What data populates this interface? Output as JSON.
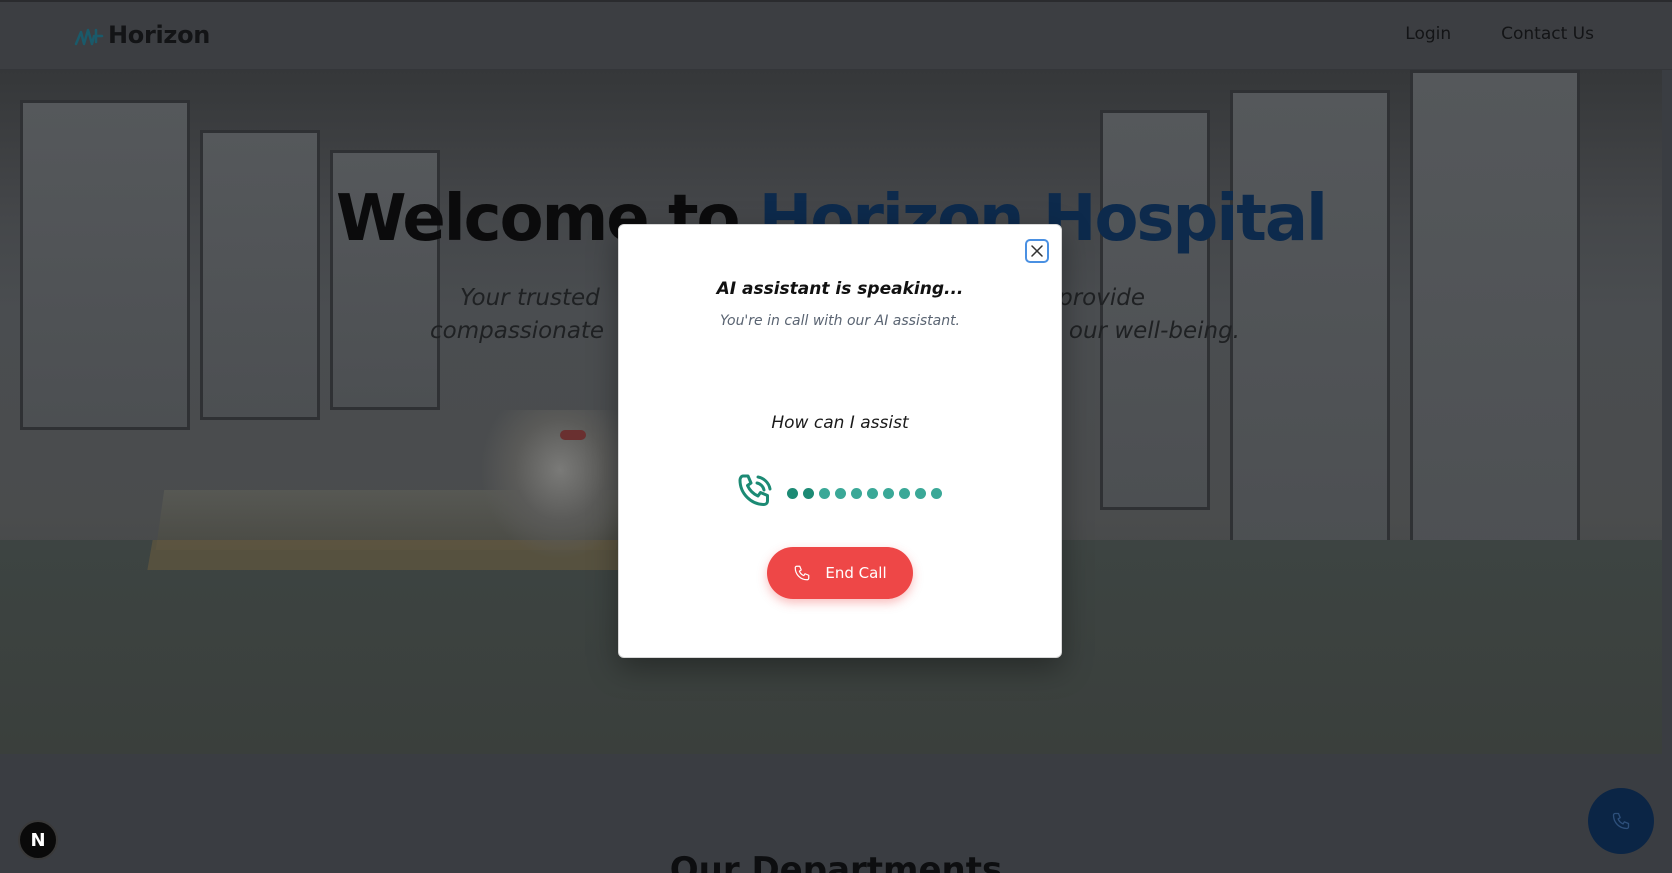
{
  "header": {
    "brand_name": "Horizon",
    "nav": [
      {
        "label": "Login"
      },
      {
        "label": "Contact Us"
      }
    ]
  },
  "hero": {
    "title_lead": "Welcome to",
    "title_accent": "Horizon Hospital",
    "subtitle_left_1": "Your trusted",
    "subtitle_right_1": "We provide",
    "subtitle_left_2": "compassionate",
    "subtitle_right_2": "our well-being."
  },
  "departments": {
    "title": "Our Departments"
  },
  "modal": {
    "title": "AI assistant is speaking...",
    "subtitle": "You're in call with our AI assistant.",
    "message": "How can I assist",
    "end_call_label": "End Call",
    "wave_dots": 10,
    "icons": {
      "close": "close-icon",
      "call": "phone-ringing-icon",
      "end_call": "phone-icon"
    }
  },
  "badge": {
    "label": "N"
  },
  "colors": {
    "accent_teal": "#1c8a74",
    "end_call_red": "#ee4747",
    "brand_navy": "#0b2545"
  }
}
